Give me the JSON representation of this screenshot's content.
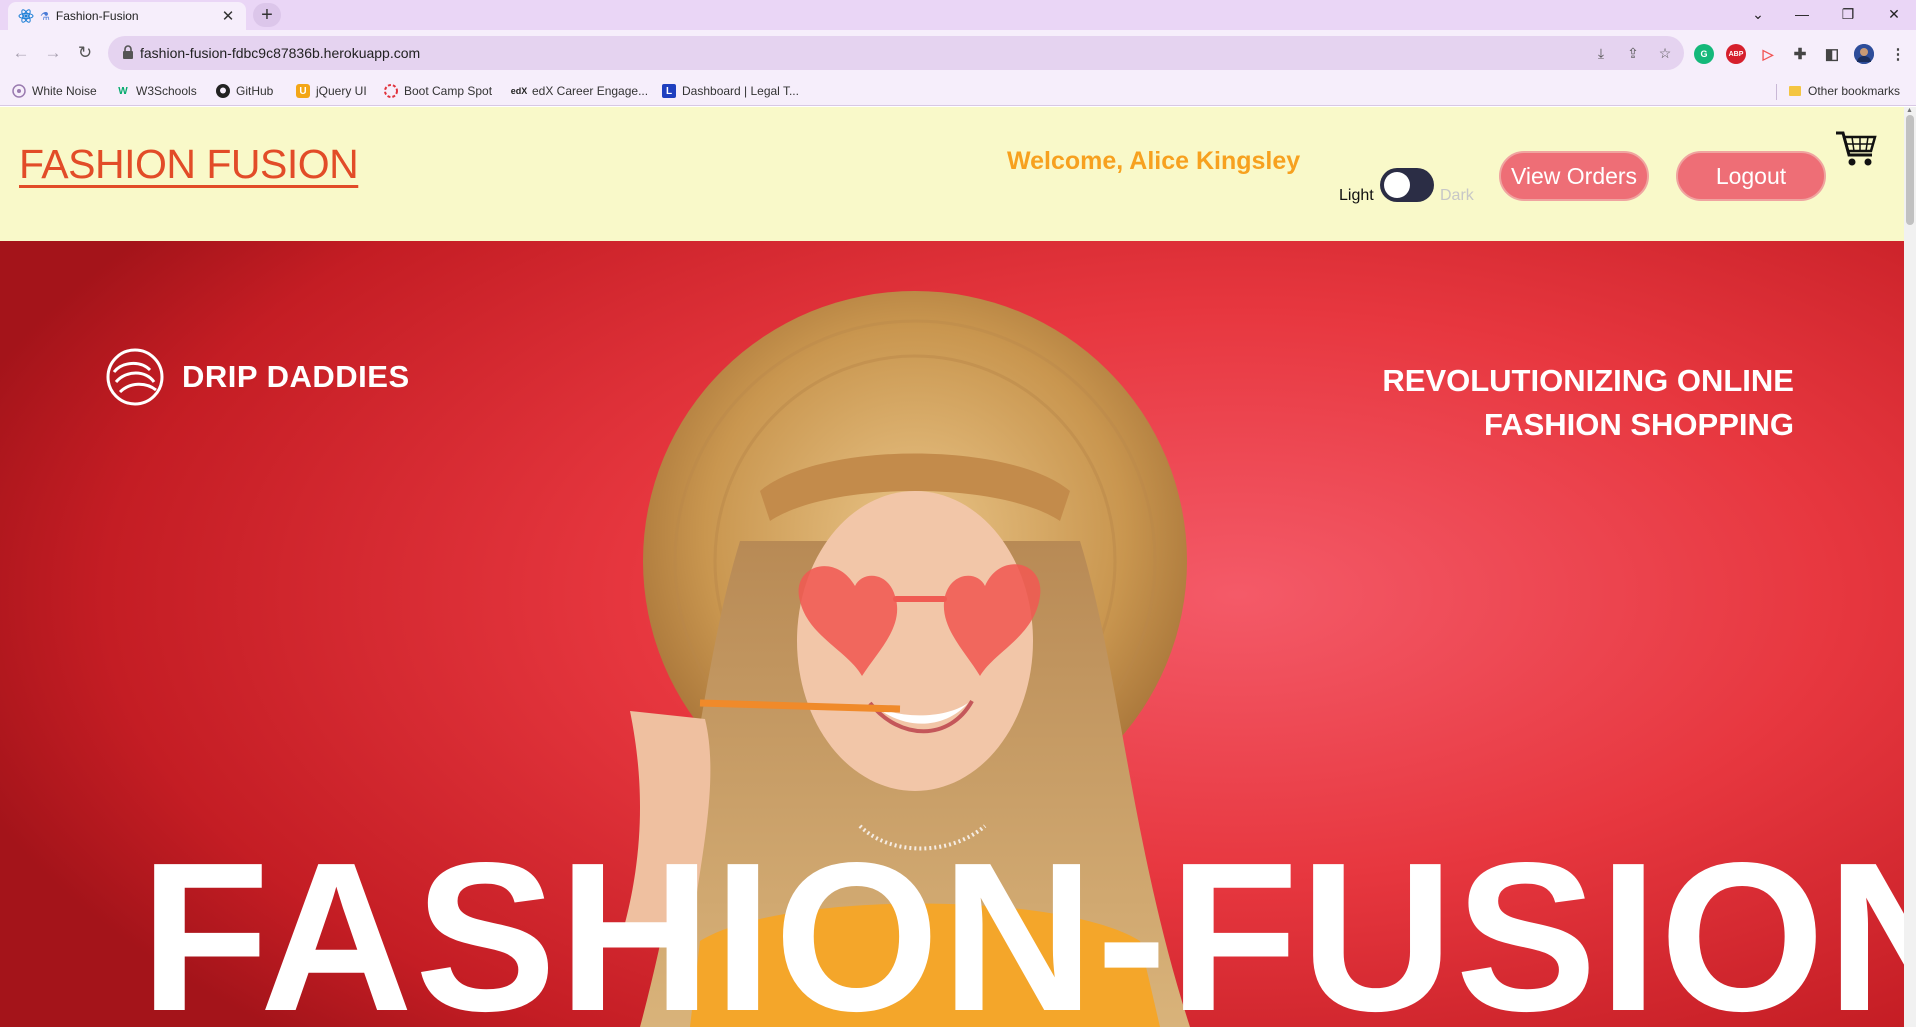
{
  "browser": {
    "tab_title": "Fashion-Fusion",
    "url": "fashion-fusion-fdbc9c87836b.herokuapp.com",
    "bookmarks": [
      {
        "label": "White Noise",
        "icon": "white-noise-icon"
      },
      {
        "label": "W3Schools",
        "icon": "w3schools-icon"
      },
      {
        "label": "GitHub",
        "icon": "github-icon"
      },
      {
        "label": "jQuery UI",
        "icon": "jquery-icon"
      },
      {
        "label": "Boot Camp Spot",
        "icon": "bootcamp-icon"
      },
      {
        "label": "edX Career Engage...",
        "icon": "edx-icon"
      },
      {
        "label": "Dashboard | Legal T...",
        "icon": "dashboard-icon"
      }
    ],
    "other_bookmarks": "Other bookmarks"
  },
  "header": {
    "brand": "FASHION FUSION",
    "welcome": "Welcome, Alice Kingsley",
    "theme_toggle": {
      "light_label": "Light",
      "dark_label": "Dark",
      "state": "light"
    },
    "view_orders_label": "View Orders",
    "logout_label": "Logout"
  },
  "hero": {
    "brand": "DRIP DADDIES",
    "tagline_line1": "REVOLUTIONIZING ONLINE",
    "tagline_line2": "FASHION SHOPPING",
    "title": "FASHION-FUSION"
  },
  "colors": {
    "header_bg": "#f9f9c9",
    "brand": "#e24c28",
    "welcome": "#f7a11f",
    "button": "#ee6e76",
    "hero_red": "#e7373f",
    "browser_chrome": "#ead6f6"
  }
}
